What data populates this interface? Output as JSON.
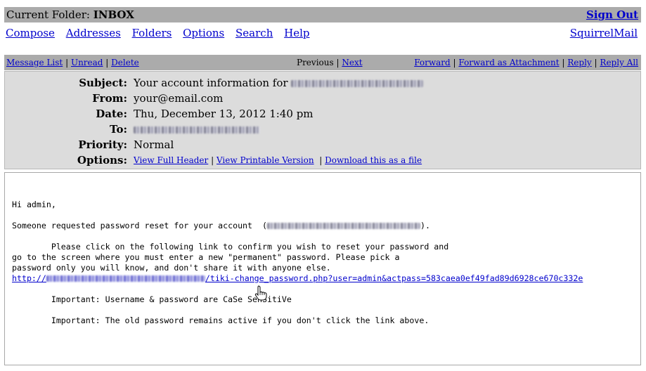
{
  "topbar": {
    "folder_label": "Current Folder:",
    "folder_name": "INBOX",
    "sign_out": "Sign Out"
  },
  "menu": {
    "items": [
      "Compose",
      "Addresses",
      "Folders",
      "Options",
      "Search",
      "Help"
    ],
    "brand": "SquirrelMail"
  },
  "msgbar": {
    "message_list": "Message List",
    "unread": "Unread",
    "delete": "Delete",
    "previous": "Previous",
    "next": "Next",
    "forward": "Forward",
    "forward_attachment": "Forward as Attachment",
    "reply": "Reply",
    "reply_all": "Reply All",
    "sep": "|"
  },
  "header": {
    "subject_label": "Subject:",
    "subject_value": "Your account information for",
    "from_label": "From:",
    "from_value": "your@email.com",
    "date_label": "Date:",
    "date_value": "Thu, December 13, 2012 1:40 pm",
    "to_label": "To:",
    "priority_label": "Priority:",
    "priority_value": "Normal",
    "options_label": "Options:",
    "view_full_header": "View Full Header",
    "view_printable": "View Printable Version",
    "download_file": "Download this as a file"
  },
  "body": {
    "greeting": "Hi admin,",
    "line1_a": "Someone requested password reset for your account  (",
    "line1_b": ").",
    "para1": "        Please click on the following link to confirm you wish to reset your password and\ngo to the screen where you must enter a new \"permanent\" password. Please pick a\npassword only you will know, and don't share it with anyone else.",
    "link_prefix": "http://",
    "link_suffix": "/tiki-change_password.php?user=admin&actpass=583caea0ef49fad89d6928ce670c332e",
    "important1": "        Important: Username & password are CaSe SenSitiVe",
    "important2": "        Important: The old password remains active if you don't click the link above."
  },
  "icons": {
    "cursor": "hand-pointer-icon"
  }
}
